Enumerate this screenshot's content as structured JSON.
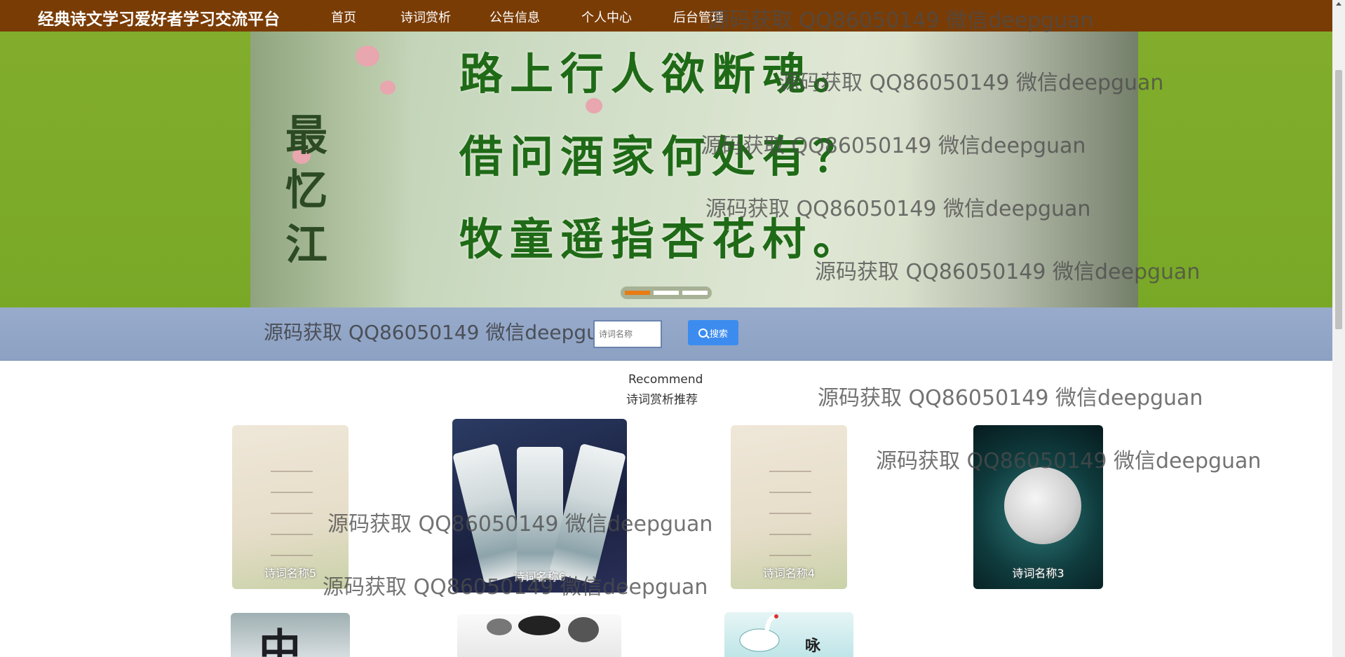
{
  "header": {
    "site_title": "经典诗文学习爱好者学习交流平台",
    "nav": [
      {
        "label": "首页"
      },
      {
        "label": "诗词赏析"
      },
      {
        "label": "公告信息"
      },
      {
        "label": "个人中心"
      },
      {
        "label": "后台管理"
      }
    ]
  },
  "banner": {
    "poem_lines": [
      "路上行人欲断魂。",
      "借问酒家何处有？",
      "牧童遥指杏花村。"
    ],
    "calligraphy": "最忆江",
    "slide_count": 3,
    "active_slide": 1
  },
  "search": {
    "label": "源码获取 QQ86050149 微信deepguan",
    "placeholder": "诗词名称",
    "button_label": "搜索"
  },
  "recommend": {
    "title_en": "Recommend",
    "title_cn": "诗词赏析推荐",
    "cards": [
      {
        "label": "诗词名称5"
      },
      {
        "label": "诗词名称6"
      },
      {
        "label": "诗词名称4"
      },
      {
        "label": "诗词名称3"
      },
      {
        "label": "中"
      },
      {
        "label": ""
      },
      {
        "label": "咏 鹅"
      }
    ]
  },
  "watermark": "源码获取 QQ86050149 微信deepguan",
  "colors": {
    "nav_bg": "#7a3c05",
    "banner_bg": "#82ad2c",
    "search_bg": "#98abcc",
    "search_button": "#3c8cf0",
    "active_dot": "#e87b14"
  }
}
